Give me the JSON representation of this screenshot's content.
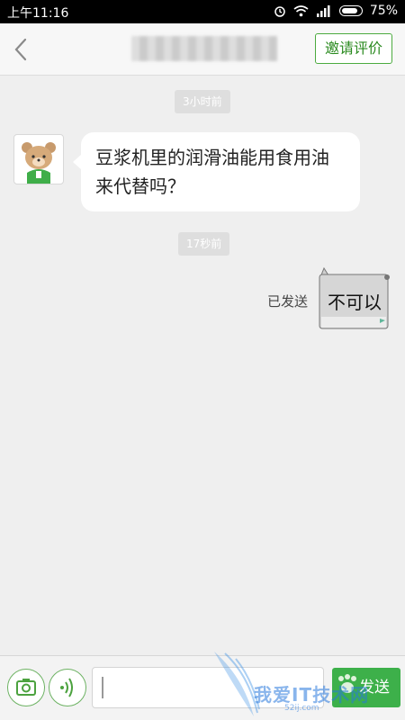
{
  "status_bar": {
    "time": "上午11:16",
    "battery": "75%",
    "battery_level": 0.75
  },
  "header": {
    "invite_label": "邀请评价"
  },
  "chat": {
    "time_1": "3小时前",
    "incoming_message": "豆浆机里的润滑油能用食用油来代替吗？",
    "time_2": "17秒前",
    "sent_status": "已发送",
    "sticker_text": "不可以"
  },
  "footer": {
    "send_label": "发送",
    "input_value": ""
  },
  "watermark": {
    "text": "我爱IT技术网",
    "url": "52ij.com"
  },
  "colors": {
    "accent": "#3db04a",
    "header_bg": "#f7f7f7",
    "chat_bg": "#efefef"
  }
}
